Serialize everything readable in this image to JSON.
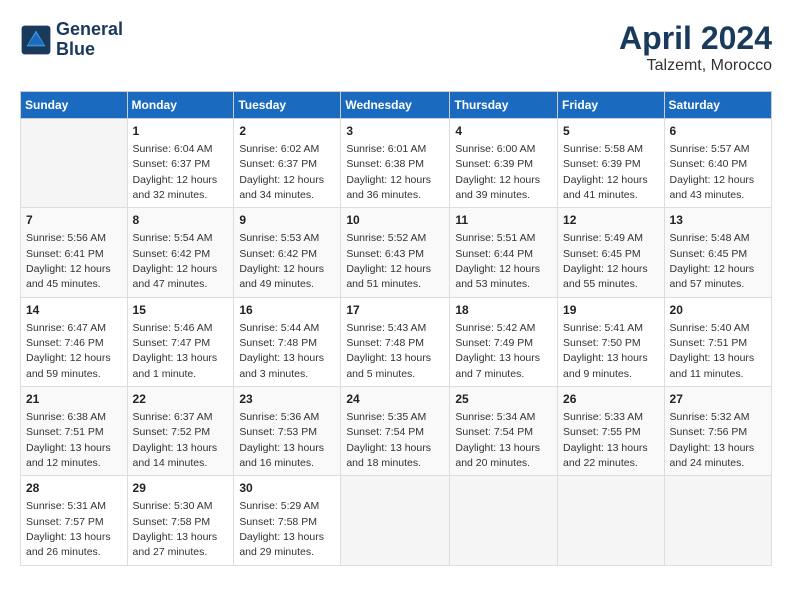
{
  "header": {
    "logo_line1": "General",
    "logo_line2": "Blue",
    "month_title": "April 2024",
    "location": "Talzemt, Morocco"
  },
  "days_of_week": [
    "Sunday",
    "Monday",
    "Tuesday",
    "Wednesday",
    "Thursday",
    "Friday",
    "Saturday"
  ],
  "weeks": [
    [
      {
        "day": "",
        "content": ""
      },
      {
        "day": "1",
        "content": "Sunrise: 6:04 AM\nSunset: 6:37 PM\nDaylight: 12 hours\nand 32 minutes."
      },
      {
        "day": "2",
        "content": "Sunrise: 6:02 AM\nSunset: 6:37 PM\nDaylight: 12 hours\nand 34 minutes."
      },
      {
        "day": "3",
        "content": "Sunrise: 6:01 AM\nSunset: 6:38 PM\nDaylight: 12 hours\nand 36 minutes."
      },
      {
        "day": "4",
        "content": "Sunrise: 6:00 AM\nSunset: 6:39 PM\nDaylight: 12 hours\nand 39 minutes."
      },
      {
        "day": "5",
        "content": "Sunrise: 5:58 AM\nSunset: 6:39 PM\nDaylight: 12 hours\nand 41 minutes."
      },
      {
        "day": "6",
        "content": "Sunrise: 5:57 AM\nSunset: 6:40 PM\nDaylight: 12 hours\nand 43 minutes."
      }
    ],
    [
      {
        "day": "7",
        "content": "Sunrise: 5:56 AM\nSunset: 6:41 PM\nDaylight: 12 hours\nand 45 minutes."
      },
      {
        "day": "8",
        "content": "Sunrise: 5:54 AM\nSunset: 6:42 PM\nDaylight: 12 hours\nand 47 minutes."
      },
      {
        "day": "9",
        "content": "Sunrise: 5:53 AM\nSunset: 6:42 PM\nDaylight: 12 hours\nand 49 minutes."
      },
      {
        "day": "10",
        "content": "Sunrise: 5:52 AM\nSunset: 6:43 PM\nDaylight: 12 hours\nand 51 minutes."
      },
      {
        "day": "11",
        "content": "Sunrise: 5:51 AM\nSunset: 6:44 PM\nDaylight: 12 hours\nand 53 minutes."
      },
      {
        "day": "12",
        "content": "Sunrise: 5:49 AM\nSunset: 6:45 PM\nDaylight: 12 hours\nand 55 minutes."
      },
      {
        "day": "13",
        "content": "Sunrise: 5:48 AM\nSunset: 6:45 PM\nDaylight: 12 hours\nand 57 minutes."
      }
    ],
    [
      {
        "day": "14",
        "content": "Sunrise: 6:47 AM\nSunset: 7:46 PM\nDaylight: 12 hours\nand 59 minutes."
      },
      {
        "day": "15",
        "content": "Sunrise: 5:46 AM\nSunset: 7:47 PM\nDaylight: 13 hours\nand 1 minute."
      },
      {
        "day": "16",
        "content": "Sunrise: 5:44 AM\nSunset: 7:48 PM\nDaylight: 13 hours\nand 3 minutes."
      },
      {
        "day": "17",
        "content": "Sunrise: 5:43 AM\nSunset: 7:48 PM\nDaylight: 13 hours\nand 5 minutes."
      },
      {
        "day": "18",
        "content": "Sunrise: 5:42 AM\nSunset: 7:49 PM\nDaylight: 13 hours\nand 7 minutes."
      },
      {
        "day": "19",
        "content": "Sunrise: 5:41 AM\nSunset: 7:50 PM\nDaylight: 13 hours\nand 9 minutes."
      },
      {
        "day": "20",
        "content": "Sunrise: 5:40 AM\nSunset: 7:51 PM\nDaylight: 13 hours\nand 11 minutes."
      }
    ],
    [
      {
        "day": "21",
        "content": "Sunrise: 6:38 AM\nSunset: 7:51 PM\nDaylight: 13 hours\nand 12 minutes."
      },
      {
        "day": "22",
        "content": "Sunrise: 6:37 AM\nSunset: 7:52 PM\nDaylight: 13 hours\nand 14 minutes."
      },
      {
        "day": "23",
        "content": "Sunrise: 5:36 AM\nSunset: 7:53 PM\nDaylight: 13 hours\nand 16 minutes."
      },
      {
        "day": "24",
        "content": "Sunrise: 5:35 AM\nSunset: 7:54 PM\nDaylight: 13 hours\nand 18 minutes."
      },
      {
        "day": "25",
        "content": "Sunrise: 5:34 AM\nSunset: 7:54 PM\nDaylight: 13 hours\nand 20 minutes."
      },
      {
        "day": "26",
        "content": "Sunrise: 5:33 AM\nSunset: 7:55 PM\nDaylight: 13 hours\nand 22 minutes."
      },
      {
        "day": "27",
        "content": "Sunrise: 5:32 AM\nSunset: 7:56 PM\nDaylight: 13 hours\nand 24 minutes."
      }
    ],
    [
      {
        "day": "28",
        "content": "Sunrise: 5:31 AM\nSunset: 7:57 PM\nDaylight: 13 hours\nand 26 minutes."
      },
      {
        "day": "29",
        "content": "Sunrise: 5:30 AM\nSunset: 7:58 PM\nDaylight: 13 hours\nand 27 minutes."
      },
      {
        "day": "30",
        "content": "Sunrise: 5:29 AM\nSunset: 7:58 PM\nDaylight: 13 hours\nand 29 minutes."
      },
      {
        "day": "",
        "content": ""
      },
      {
        "day": "",
        "content": ""
      },
      {
        "day": "",
        "content": ""
      },
      {
        "day": "",
        "content": ""
      }
    ]
  ]
}
